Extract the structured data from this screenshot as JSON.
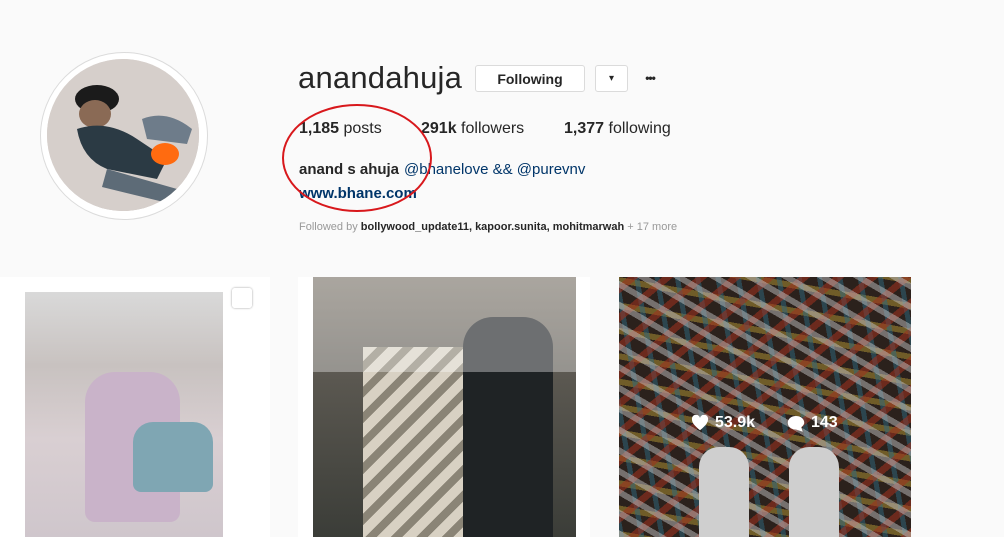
{
  "profile": {
    "username": "anandahuja",
    "following_button": "Following",
    "dropdown_icon": "▾",
    "more_icon": "•••"
  },
  "stats": {
    "posts_count": "1,185",
    "posts_label": "posts",
    "followers_count": "291k",
    "followers_label": "followers",
    "following_count": "1,377",
    "following_label": "following"
  },
  "bio": {
    "full_name": "anand s ahuja",
    "mentions": "@bhanelove && @purevnv",
    "website": "www.bhane.com"
  },
  "followed_by": {
    "prefix": "Followed by",
    "names": "bollywood_update11, kapoor.sunita, mohitmarwah",
    "more": "+ 17 more"
  },
  "posts": [
    {
      "type": "multi-image"
    },
    {
      "type": "image"
    },
    {
      "type": "image",
      "likes": "53.9k",
      "comments": "143"
    }
  ],
  "colors": {
    "annotation_circle": "#d8181c",
    "link": "#003569"
  }
}
